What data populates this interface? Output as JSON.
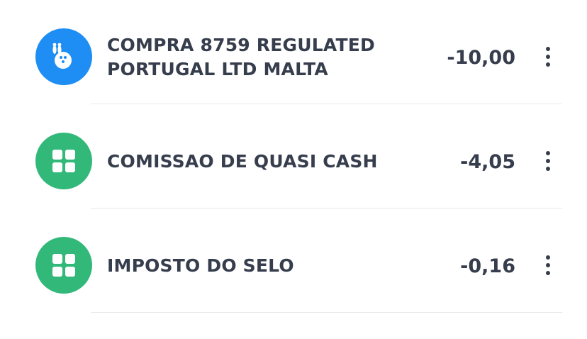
{
  "transactions": [
    {
      "description": "COMPRA 8759 REGULATED PORTUGAL LTD MALTA",
      "amount": "-10,00",
      "icon": "bowling-icon",
      "icon_color": "#1e8ef5"
    },
    {
      "description": "COMISSAO DE QUASI CASH",
      "amount": "-4,05",
      "icon": "grid-icon",
      "icon_color": "#32b97a"
    },
    {
      "description": "IMPOSTO DO SELO",
      "amount": "-0,16",
      "icon": "grid-icon",
      "icon_color": "#32b97a"
    }
  ]
}
